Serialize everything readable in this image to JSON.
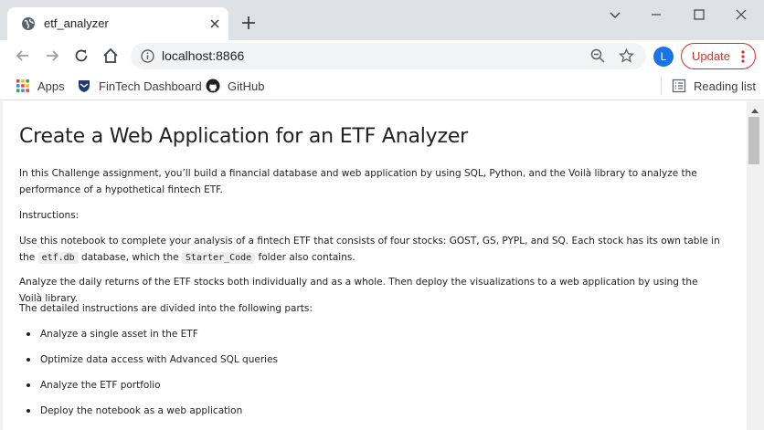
{
  "tab": {
    "title": "etf_analyzer"
  },
  "address": {
    "url": "localhost:8866"
  },
  "profile": {
    "initial": "L"
  },
  "update": {
    "label": "Update"
  },
  "bookmarks": [
    {
      "label": "Apps",
      "icon": "apps-grid-icon"
    },
    {
      "label": "FinTech Dashboard",
      "icon": "shield-crest-icon"
    },
    {
      "label": "GitHub",
      "icon": "github-icon"
    }
  ],
  "reading_list": {
    "label": "Reading list"
  },
  "doc": {
    "title": "Create a Web Application for an ETF Analyzer",
    "intro": "In this Challenge assignment, you’ll build a financial database and web application by using SQL, Python, and the Voilà library to analyze the performance of a hypothetical fintech ETF.",
    "instructions_label": "Instructions:",
    "para1_a": "Use this notebook to complete your analysis of a fintech ETF that consists of four stocks: GOST, GS, PYPL, and SQ. Each stock has its own table in the",
    "para1_code1": "etf.db",
    "para1_b": "database, which the",
    "para1_code2": "Starter_Code",
    "para1_c": "folder also contains.",
    "para2": "Analyze the daily returns of the ETF stocks both individually and as a whole. Then deploy the visualizations to a web application by using the Voilà library.",
    "para3": "The detailed instructions are divided into the following parts:",
    "parts": [
      "Analyze a single asset in the ETF",
      "Optimize data access with Advanced SQL queries",
      "Analyze the ETF portfolio",
      "Deploy the notebook as a web application"
    ]
  },
  "colors": {
    "accent": "#1a73e8",
    "update": "#d93025",
    "tabstrip": "#dee1e6"
  }
}
